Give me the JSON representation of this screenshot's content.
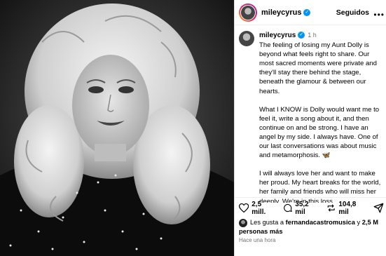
{
  "post": {
    "username": "mileycyrus",
    "follow_label": "Seguidos",
    "more_icon": "more-horizontal-icon",
    "time": "1 h",
    "caption": [
      "The feeling of losing my Aunt Dolly is beyond what feels right to share. Our most sacred moments were private and they'll stay there behind the stage, beneath the glamour & between our hearts.",
      "What I KNOW is Dolly would want me to feel it, write a song about it, and then continue on and be strong. I have an angel by my side. I always have. One of our last conversations was about music and metamorphosis. 🦋",
      "I will always love her and want to make her proud. My heart breaks for the world, her family and friends who will miss her deeply. We're in this loss"
    ]
  },
  "actions": {
    "likes": "2,5 mill.",
    "comments": "35,2 mil",
    "shares": "104,8 mil"
  },
  "liked_by": {
    "prefix": "Les gusta a",
    "user": "fernandacastromusica",
    "conj": "y",
    "others": "2,5 M personas más"
  },
  "posted_ago": "Hace una hora",
  "colors": {
    "verified": "#0095f6",
    "muted": "#737373"
  }
}
